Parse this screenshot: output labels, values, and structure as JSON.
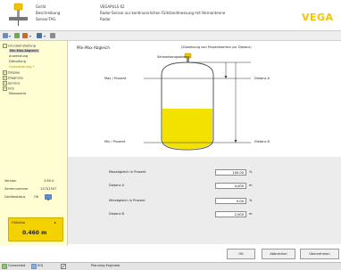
{
  "header": {
    "fields": [
      {
        "label": "Gerät",
        "value": "VEGAPULS 62"
      },
      {
        "label": "Beschreibung",
        "value": "Radar-Sensor zur kontinuierlichen Füllstandmessung mit Hornantenne"
      },
      {
        "label": "Sensor-TAG",
        "value": "Radar"
      }
    ],
    "logo": "VEGA",
    "brand_color": "#f2c500"
  },
  "toolbar": {
    "icons": [
      "menu-icon",
      "device-icon",
      "wrench-icon",
      "grid-icon",
      "arrow-icon"
    ]
  },
  "tree": [
    {
      "label": "Grundeinstellung",
      "level": 0,
      "toggle": "-"
    },
    {
      "label": "Min-Max-Abgleich",
      "level": 1,
      "selected": true
    },
    {
      "label": "Anwendung",
      "level": 1
    },
    {
      "label": "Dämpfung",
      "level": 1
    },
    {
      "label": "Linearisierung *",
      "level": 1,
      "highlight": true
    },
    {
      "label": "Display",
      "level": 0,
      "toggle": "+"
    },
    {
      "label": "Diagnose",
      "level": 0,
      "toggle": "+"
    },
    {
      "label": "Service",
      "level": 0,
      "toggle": "+"
    },
    {
      "label": "Info",
      "level": 0,
      "toggle": "+"
    },
    {
      "label": "Messwerte",
      "level": 0
    }
  ],
  "info": {
    "version_label": "Version",
    "version_value": "3.80.0",
    "serial_label": "Seriennummer",
    "serial_value": "13741307",
    "status_label": "Gerätestatus",
    "status_value": "OK",
    "fill_label": "Füllhöhe",
    "fill_value": "0.460 m"
  },
  "main": {
    "title": "Min-Max Abgleich",
    "subtitle": "(Zuweisung von Prozentwerten zur Distanz)",
    "sensor_label": "Sensorbezugsebene",
    "max_label": "Max / Prozent",
    "min_label": "Min / Prozent",
    "dist_a_label": "Distanz A",
    "dist_b_label": "Distanz B"
  },
  "form": {
    "rows": [
      {
        "label": "Maxabgleich in Prozent",
        "value": "100.00",
        "unit": "%"
      },
      {
        "label": "Distanz A",
        "value": "0,000",
        "unit": "m"
      },
      {
        "label": "Minabgleich in Prozent",
        "value": "0.00",
        "unit": "%"
      },
      {
        "label": "Distanz B",
        "value": "2,000",
        "unit": "m"
      }
    ]
  },
  "buttons": {
    "ok": "OK",
    "cancel": "Abbrechen",
    "apply": "Übernehmen"
  },
  "statusbar": {
    "connected": "Connected",
    "box2": "SOJ",
    "pending": "Planning Engineer"
  }
}
